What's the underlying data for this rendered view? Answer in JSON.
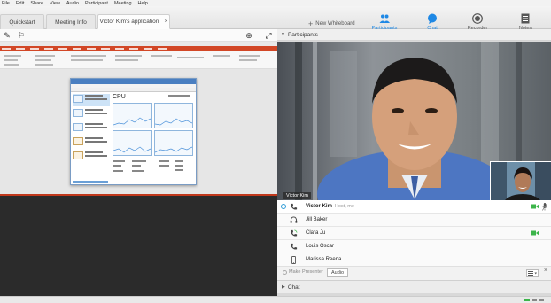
{
  "menu": [
    "File",
    "Edit",
    "Share",
    "View",
    "Audio",
    "Participant",
    "Meeting",
    "Help"
  ],
  "tabs": [
    {
      "label": "Quickstart",
      "active": false
    },
    {
      "label": "Meeting Info",
      "active": false
    },
    {
      "label": "Victor Kim's application",
      "active": true
    }
  ],
  "toolbar": {
    "new_whiteboard": "New Whiteboard",
    "participants": "Participants",
    "chat": "Chat",
    "recorder": "Recorder",
    "notes": "Notes"
  },
  "task_manager": {
    "cpu_label": "CPU"
  },
  "panel": {
    "participants_title": "Participants",
    "video_name": "Victor Kim",
    "chat_title": "Chat",
    "make_presenter": "Make Presenter",
    "audio_button": "Audio"
  },
  "participants": [
    {
      "name": "Victor Kim",
      "role": "Host, me",
      "icon": "phone-icon",
      "camera": true,
      "self": true
    },
    {
      "name": "Jill Baker",
      "role": "",
      "icon": "headset-icon",
      "camera": false
    },
    {
      "name": "Clara Ju",
      "role": "",
      "icon": "phone-speaking-icon",
      "camera": true
    },
    {
      "name": "Louis Oscar",
      "role": "",
      "icon": "phone-icon",
      "camera": false
    },
    {
      "name": "Marissa Reena",
      "role": "",
      "icon": "mobile-icon",
      "camera": false
    }
  ],
  "colors": {
    "accent": "#1e88e5",
    "powerpoint": "#d24726",
    "video_on": "#3cb54a"
  }
}
